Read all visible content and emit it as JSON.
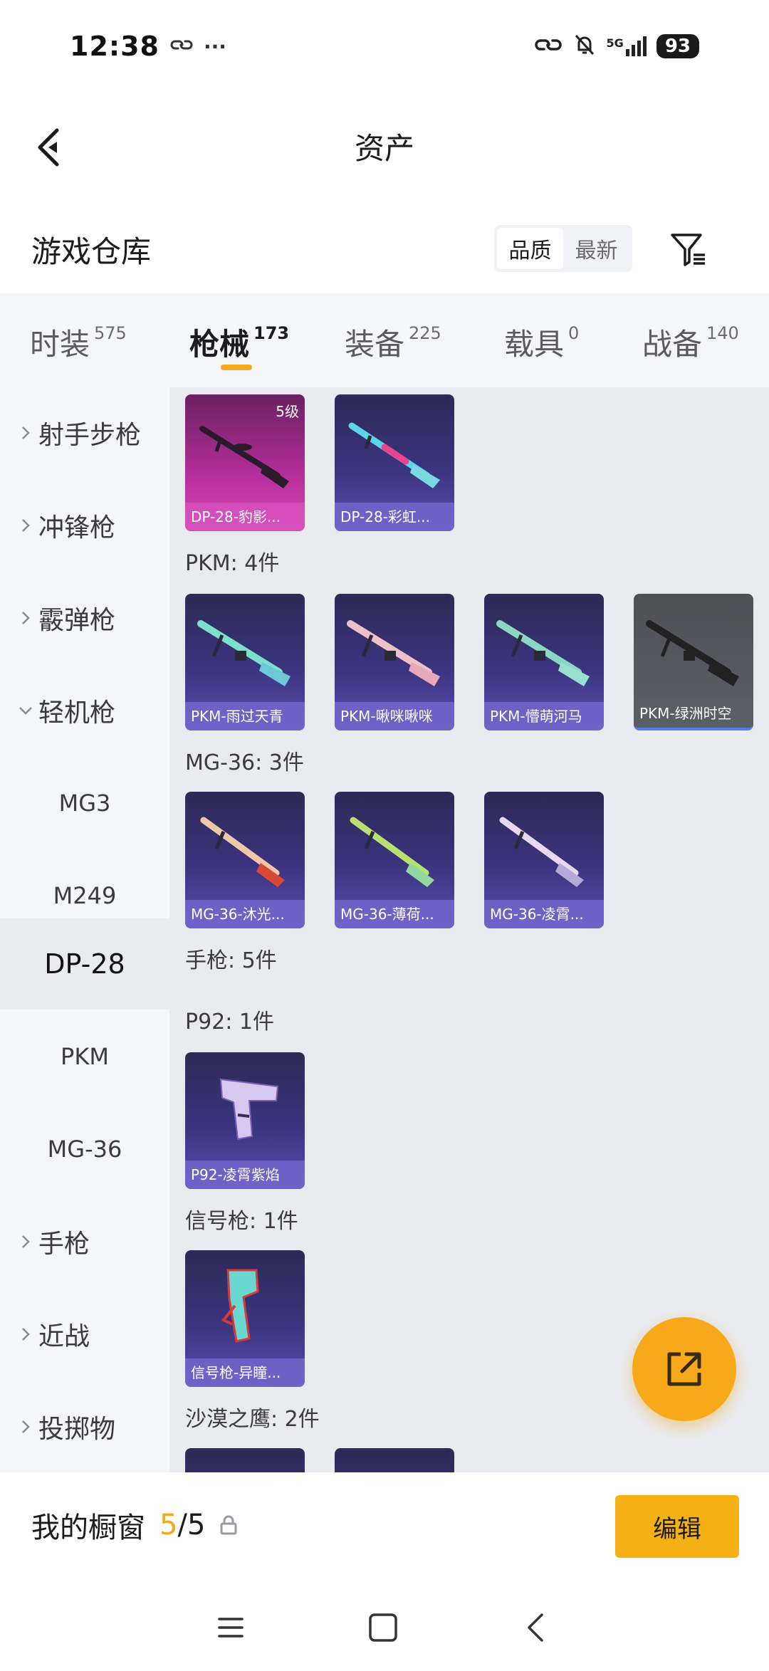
{
  "status_bar": {
    "time": "12:38",
    "extra": "···",
    "network": "5G",
    "battery": "93"
  },
  "header": {
    "title": "资产"
  },
  "warehouse": {
    "title": "游戏仓库",
    "sort_options": [
      "品质",
      "最新"
    ],
    "active_sort": "品质"
  },
  "tabs": [
    {
      "label": "时装",
      "count": "575"
    },
    {
      "label": "枪械",
      "count": "173"
    },
    {
      "label": "装备",
      "count": "225"
    },
    {
      "label": "载具",
      "count": "0"
    },
    {
      "label": "战备",
      "count": "140"
    }
  ],
  "sidebar": [
    {
      "label": "射手步枪",
      "type": "category"
    },
    {
      "label": "冲锋枪",
      "type": "category"
    },
    {
      "label": "霰弹枪",
      "type": "category"
    },
    {
      "label": "轻机枪",
      "type": "category-expanded"
    },
    {
      "label": "MG3",
      "type": "sub"
    },
    {
      "label": "M249",
      "type": "sub"
    },
    {
      "label": "DP-28",
      "type": "sub-selected"
    },
    {
      "label": "PKM",
      "type": "sub"
    },
    {
      "label": "MG-36",
      "type": "sub"
    },
    {
      "label": "手枪",
      "type": "category"
    },
    {
      "label": "近战",
      "type": "category"
    },
    {
      "label": "投掷物",
      "type": "category"
    }
  ],
  "content": {
    "dp28_items": [
      {
        "name": "DP-28-豹影...",
        "level": "5级",
        "rarity": "pink"
      },
      {
        "name": "DP-28-彩虹...",
        "rarity": "purple"
      }
    ],
    "pkm_title": "PKM: 4件",
    "pkm_items": [
      {
        "name": "PKM-雨过天青",
        "rarity": "purple"
      },
      {
        "name": "PKM-啾咪啾咪",
        "rarity": "purple"
      },
      {
        "name": "PKM-懵萌河马",
        "rarity": "purple"
      },
      {
        "name": "PKM-绿洲时空",
        "rarity": "gray"
      }
    ],
    "mg36_title": "MG-36: 3件",
    "mg36_items": [
      {
        "name": "MG-36-沐光...",
        "rarity": "purple"
      },
      {
        "name": "MG-36-薄荷...",
        "rarity": "purple"
      },
      {
        "name": "MG-36-凌霄...",
        "rarity": "purple"
      }
    ],
    "pistol_title": "手枪: 5件",
    "p92_title": "P92: 1件",
    "p92_items": [
      {
        "name": "P92-凌霄紫焰",
        "rarity": "purple"
      }
    ],
    "flare_title": "信号枪: 1件",
    "flare_items": [
      {
        "name": "信号枪-异瞳...",
        "rarity": "purple"
      }
    ],
    "deagle_title": "沙漠之鹰: 2件"
  },
  "showcase": {
    "label": "我的橱窗",
    "count": "5",
    "slash": "/",
    "total": "5",
    "edit_label": "编辑"
  },
  "colors": {
    "accent": "#f5a91a",
    "card_purple": "#3b3480",
    "card_pink": "#b52e9c",
    "card_gray": "#5c5d66",
    "sidebar_bg": "#f5f6f9",
    "content_bg": "#e9ebf0"
  }
}
